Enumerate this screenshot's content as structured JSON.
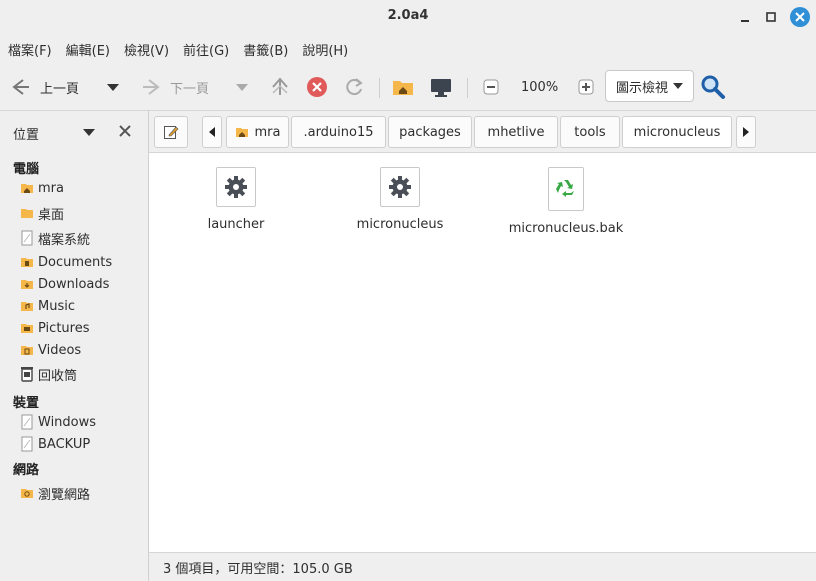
{
  "window": {
    "title": "2.0a4"
  },
  "menu": [
    "檔案(F)",
    "編輯(E)",
    "檢視(V)",
    "前往(G)",
    "書籤(B)",
    "說明(H)"
  ],
  "toolbar": {
    "back_label": "上一頁",
    "forward_label": "下一頁",
    "zoom": "100%",
    "view_mode": "圖示檢視"
  },
  "sidebar": {
    "header": "位置",
    "sections": {
      "computer": "電腦",
      "devices": "裝置",
      "network": "網路"
    },
    "computer_items": [
      "mra",
      "桌面",
      "檔案系統",
      "Documents",
      "Downloads",
      "Music",
      "Pictures",
      "Videos",
      "回收筒"
    ],
    "device_items": [
      "Windows",
      "BACKUP"
    ],
    "network_items": [
      "瀏覽網路"
    ]
  },
  "path": [
    "mra",
    ".arduino15",
    "packages",
    "mhetlive",
    "tools",
    "micronucleus"
  ],
  "files": [
    {
      "name": "launcher",
      "icon": "gear-icon"
    },
    {
      "name": "micronucleus",
      "icon": "gear-icon"
    },
    {
      "name": "micronucleus.bak",
      "icon": "recycle-icon"
    }
  ],
  "status": "3 個項目，可用空間：105.0 GB",
  "colors": {
    "accent": "#2f8fd7",
    "folder": "#f5b74a",
    "stop": "#e05a5a",
    "recycle": "#38a845"
  }
}
